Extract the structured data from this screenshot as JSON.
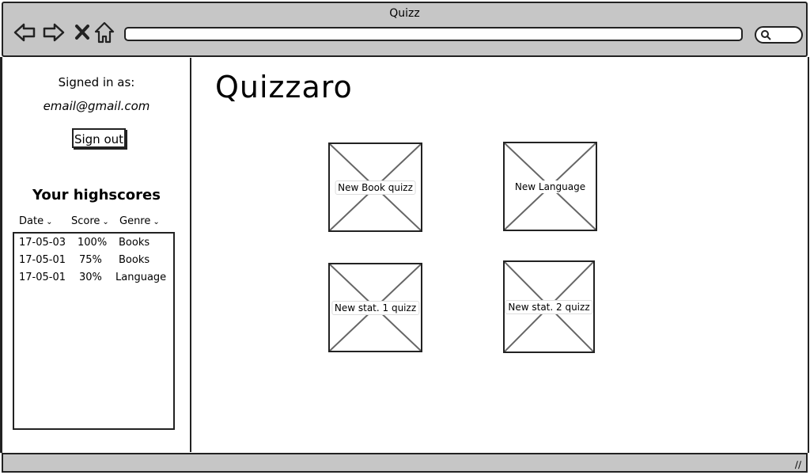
{
  "window": {
    "title": "Quizz"
  },
  "sidebar": {
    "signed_in_label": "Signed in as:",
    "email": "email@gmail.com",
    "sign_out_label": "Sign out",
    "highscores_title": "Your highscores",
    "columns": [
      "Date",
      "Score",
      "Genre"
    ],
    "rows": [
      {
        "date": "17-05-03",
        "score": "100%",
        "genre": "Books"
      },
      {
        "date": "17-05-01",
        "score": "75%",
        "genre": "Books"
      },
      {
        "date": "17-05-01",
        "score": "30%",
        "genre": "Language"
      }
    ]
  },
  "main": {
    "title": "Quizzaro",
    "tiles": [
      {
        "label": "New Book quizz"
      },
      {
        "label": "New Language"
      },
      {
        "label": "New stat. 1 quizz"
      },
      {
        "label": "New stat. 2 quizz"
      }
    ]
  }
}
